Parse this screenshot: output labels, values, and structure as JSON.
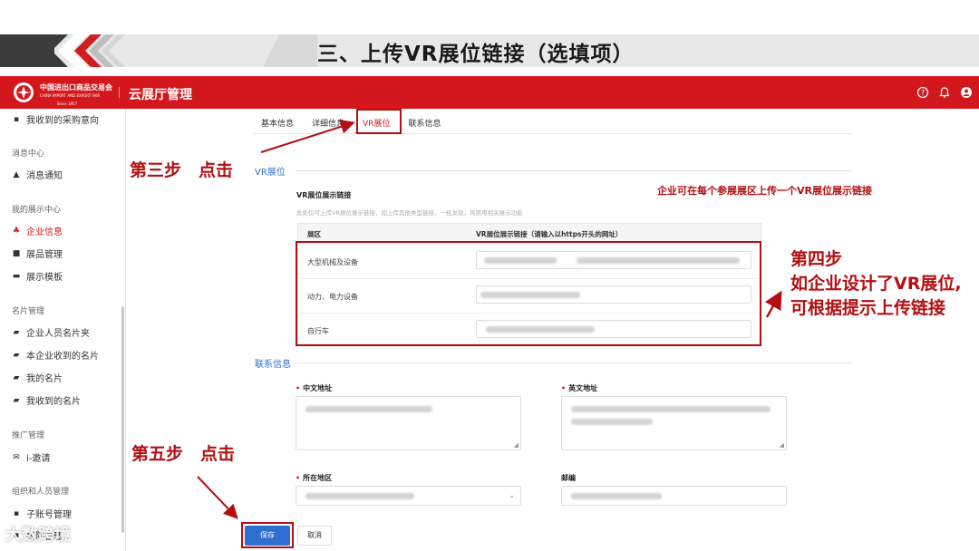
{
  "slide": {
    "title": "三、上传VR展位链接（选填项）"
  },
  "header": {
    "logo_text_line1": "中国进出口商品交易会",
    "logo_text_line2": "CHINA IMPORT AND EXPORT FAIR",
    "logo_text_line3": "Since 1957",
    "app_name": "云展厅管理",
    "icons": [
      "help-circle-icon",
      "bell-icon",
      "user-icon"
    ],
    "accent_color": "#d2181c"
  },
  "sidebar": {
    "items": [
      {
        "type": "item",
        "label": "我收到的采购意向",
        "icon": "clipboard-icon"
      },
      {
        "type": "group",
        "label": "消息中心"
      },
      {
        "type": "item",
        "label": "消息通知",
        "icon": "bell-icon"
      },
      {
        "type": "group",
        "label": "我的展示中心"
      },
      {
        "type": "item",
        "label": "企业信息",
        "icon": "org-icon",
        "active": true
      },
      {
        "type": "item",
        "label": "展品管理",
        "icon": "grid-icon"
      },
      {
        "type": "item",
        "label": "展示模板",
        "icon": "template-icon"
      },
      {
        "type": "group",
        "label": "名片管理"
      },
      {
        "type": "item",
        "label": "企业人员名片夹",
        "icon": "card-icon"
      },
      {
        "type": "item",
        "label": "本企业收到的名片",
        "icon": "card-icon"
      },
      {
        "type": "item",
        "label": "我的名片",
        "icon": "card-icon"
      },
      {
        "type": "item",
        "label": "我收到的名片",
        "icon": "card-icon"
      },
      {
        "type": "group",
        "label": "推广管理"
      },
      {
        "type": "item",
        "label": "i-邀请",
        "icon": "mail-icon"
      },
      {
        "type": "group",
        "label": "组织和人员管理"
      },
      {
        "type": "item",
        "label": "子账号管理",
        "icon": "user-icon"
      },
      {
        "type": "item",
        "label": "权限管理",
        "icon": "lock-icon"
      }
    ]
  },
  "tabs": [
    {
      "label": "基本信息",
      "active": false
    },
    {
      "label": "详细信息",
      "active": false
    },
    {
      "label": "VR展位",
      "active": true
    },
    {
      "label": "联系信息",
      "active": false
    }
  ],
  "vr_section": {
    "title": "VR展位",
    "field_label": "VR展位展示链接",
    "hint": "此处仅可上传VR展位展示链接，如上传其他类型链接，一经发现，将禁用相关展示功能",
    "table_headers": [
      "展区",
      "VR展位展示链接（请输入以https开头的网址）"
    ],
    "rows": [
      {
        "category": "大型机械及设备"
      },
      {
        "category": "动力、电力设备"
      },
      {
        "category": "自行车"
      }
    ]
  },
  "contact_section": {
    "title": "联系信息",
    "fields": {
      "cn_address": "中文地址",
      "en_address": "英文地址",
      "region": "所在地区",
      "email": "邮编"
    }
  },
  "buttons": {
    "save": "保存",
    "cancel": "取消"
  },
  "annotations": {
    "step3": "第三步　点击",
    "step5": "第五步　点击",
    "step4_lines": [
      "第四步",
      "如企业设计了VR展位,",
      "可根据提示上传链接"
    ],
    "note": "企业可在每个参展展区上传一个VR展位展示链接",
    "annotation_color": "#b30f12"
  },
  "watermark": "大数跨境"
}
